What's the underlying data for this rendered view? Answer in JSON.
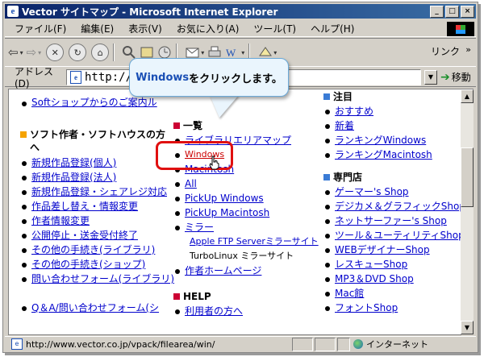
{
  "window": {
    "title": "Vector サイトマップ - Microsoft Internet Explorer",
    "ie_glyph": "e",
    "minimize": "_",
    "maximize": "□",
    "close": "×"
  },
  "menu": [
    "ファイル(F)",
    "編集(E)",
    "表示(V)",
    "お気に入り(A)",
    "ツール(T)",
    "ヘルプ(H)"
  ],
  "toolbar": {
    "back": "⇦",
    "forward": "⇨",
    "stop": "✕",
    "refresh": "↻",
    "home": "⌂",
    "links_label": "リンク",
    "links_chevron": "»"
  },
  "address": {
    "label": "アドレス(D)",
    "value": "http://w                                           tml",
    "page_glyph": "e",
    "dropdown_glyph": "▼",
    "go_arrow": "➔",
    "go_label": "移動"
  },
  "callout": {
    "keyword": "Windows",
    "text": " をクリックします。"
  },
  "content": {
    "left_top_link": "Softショップからのご案内ル",
    "left_section": "ソフト作者・ソフトハウスの方へ",
    "left_links": [
      "新規作品登録(個人)",
      "新規作品登録(法人)",
      "新規作品登録・シェアレジ対応",
      "作品差し替え・情報変更",
      "作者情報変更",
      "公開停止・送金受付終了",
      "その他の手続き(ライブラリ)",
      "その他の手続き(ショップ)",
      "問い合わせフォーム(ライブラリ)",
      "Q＆A/問い合わせフォーム(シ"
    ],
    "mid_section": "一覧",
    "mid_links": [
      "ライブラリエリアマップ",
      "Windows",
      "Macintosh",
      "All",
      "PickUp Windows",
      "PickUp Macintosh",
      "ミラー"
    ],
    "mid_sub": [
      "Apple FTP Serverミラーサイト",
      "TurboLinux ミラーサイト"
    ],
    "mid_last": "作者ホームページ",
    "help_section": "HELP",
    "help_links": [
      "利用者の方へ"
    ],
    "right_section1": "注目",
    "right_links1": [
      "おすすめ",
      "新着",
      "ランキングWindows",
      "ランキングMacintosh"
    ],
    "right_section2": "専門店",
    "right_links2": [
      "ゲーマー's Shop",
      "デジカメ＆グラフィックShop",
      "ネットサーファー's Shop",
      "ツール＆ユーティリティShop",
      "WEBデザイナーShop",
      "レスキューShop",
      "MP3＆DVD Shop",
      "Mac館",
      "フォントShop"
    ]
  },
  "status": {
    "url": "http://www.vector.co.jp/vpack/filearea/win/",
    "zone": "インターネット"
  },
  "colors": {
    "link": "#0000cc",
    "section_square_orange": "#f5a300",
    "section_square_red": "#cc0033",
    "section_square_blue": "#3a7bd5",
    "highlight": "#e01010"
  }
}
